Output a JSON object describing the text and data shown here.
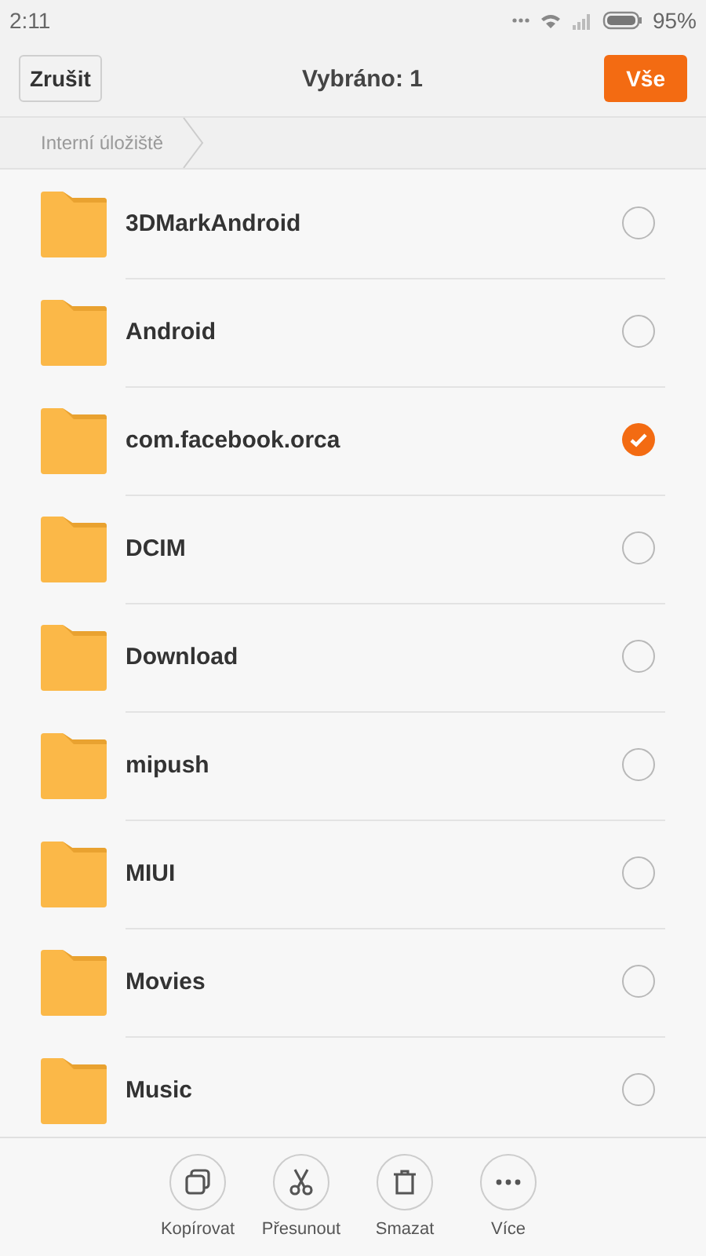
{
  "status_bar": {
    "time": "2:11",
    "battery": "95%"
  },
  "header": {
    "cancel": "Zrušit",
    "title": "Vybráno: 1",
    "select_all": "Vše"
  },
  "breadcrumb": [
    "Interní úložiště"
  ],
  "folders": [
    {
      "name": "3DMarkAndroid",
      "selected": false
    },
    {
      "name": "Android",
      "selected": false
    },
    {
      "name": "com.facebook.orca",
      "selected": true
    },
    {
      "name": "DCIM",
      "selected": false
    },
    {
      "name": "Download",
      "selected": false
    },
    {
      "name": "mipush",
      "selected": false
    },
    {
      "name": "MIUI",
      "selected": false
    },
    {
      "name": "Movies",
      "selected": false
    },
    {
      "name": "Music",
      "selected": false
    }
  ],
  "actions": [
    {
      "kind": "copy",
      "label": "Kopírovat"
    },
    {
      "kind": "move",
      "label": "Přesunout"
    },
    {
      "kind": "delete",
      "label": "Smazat"
    },
    {
      "kind": "more",
      "label": "Více"
    }
  ]
}
